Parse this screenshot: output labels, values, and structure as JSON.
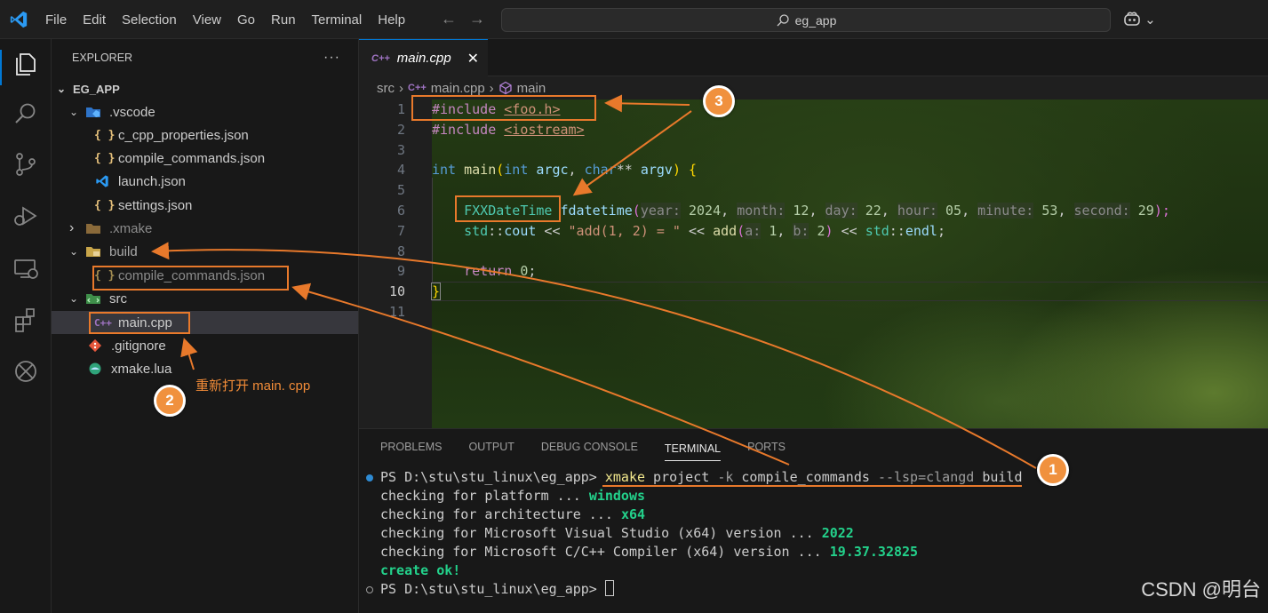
{
  "titlebar": {
    "menu": [
      "File",
      "Edit",
      "Selection",
      "View",
      "Go",
      "Run",
      "Terminal",
      "Help"
    ],
    "search_text": "eg_app",
    "back_glyph": "←",
    "forward_glyph": "→",
    "copilot_glyph": "⌄"
  },
  "sidebar": {
    "header": "EXPLORER",
    "more": "···",
    "tree": [
      {
        "label": "EG_APP",
        "kind": "root"
      },
      {
        "label": ".vscode",
        "kind": "folder-open"
      },
      {
        "label": "c_cpp_properties.json",
        "kind": "json"
      },
      {
        "label": "compile_commands.json",
        "kind": "json"
      },
      {
        "label": "launch.json",
        "kind": "vscode"
      },
      {
        "label": "settings.json",
        "kind": "json"
      },
      {
        "label": ".xmake",
        "kind": "folder-closed"
      },
      {
        "label": "build",
        "kind": "folder-open"
      },
      {
        "label": "compile_commands.json",
        "kind": "json-ignored"
      },
      {
        "label": "src",
        "kind": "folder-open"
      },
      {
        "label": "main.cpp",
        "kind": "cpp",
        "selected": true
      },
      {
        "label": ".gitignore",
        "kind": "git"
      },
      {
        "label": "xmake.lua",
        "kind": "lua"
      }
    ],
    "icons": {
      "json": "{ }",
      "cpp": "C++",
      "chevron_down": "⌄",
      "chevron_right": "›"
    }
  },
  "editor": {
    "tab_label": "main.cpp",
    "tab_close": "✕",
    "breadcrumb": [
      "src",
      "main.cpp",
      "main"
    ],
    "breadcrumb_sep": "›",
    "line_numbers": [
      "1",
      "2",
      "3",
      "4",
      "5",
      "6",
      "7",
      "8",
      "9",
      "10",
      "11"
    ],
    "code": {
      "l1_kw": "#include",
      "l1_inc": "<foo.h>",
      "l2_kw": "#include",
      "l2_inc": "<iostream>",
      "l4_int": "int",
      "l4_main": "main",
      "l4_open": "(",
      "l4_int2": "int",
      "l4_argc": "argc",
      "l4_comma": ", ",
      "l4_char": "char",
      "l4_stars": "**",
      "l4_argv": "argv",
      "l4_close": ") {",
      "l6_type": "FXXDateTime",
      "l6_var": "fdatetime",
      "l6_open": "(",
      "l6_h_year": "year:",
      "l6_v_year": "2024",
      "l6_h_month": "month:",
      "l6_v_month": "12",
      "l6_h_day": "day:",
      "l6_v_day": "22",
      "l6_h_hour": "hour:",
      "l6_v_hour": "05",
      "l6_h_minute": "minute:",
      "l6_v_minute": "53",
      "l6_h_second": "second:",
      "l6_v_second": "29",
      "l6_close": ");",
      "l6_sep": ", ",
      "l7_std": "std",
      "l7_cc": "::",
      "l7_cout": "cout",
      "l7_op": " << ",
      "l7_str": "\"add(1, 2) = \"",
      "l7_add": "add",
      "l7_open": "(",
      "l7_h_a": "a:",
      "l7_v_a": "1",
      "l7_h_b": "b:",
      "l7_v_b": "2",
      "l7_close": ")",
      "l7_std2": "std",
      "l7_endl": "endl",
      "l7_semi": ";",
      "l9_return": "return",
      "l9_zero": "0",
      "l9_semi": ";",
      "l10_brace": "}"
    }
  },
  "panel": {
    "tabs": [
      "PROBLEMS",
      "OUTPUT",
      "DEBUG CONSOLE",
      "TERMINAL",
      "PORTS"
    ],
    "active_tab": "TERMINAL",
    "terminal": {
      "prompt": "PS D:\\stu\\stu_linux\\eg_app> ",
      "cmd_xmake": "xmake",
      "cmd_project": " project ",
      "cmd_k": "-k",
      "cmd_cc": " compile_commands ",
      "cmd_lsp": "--lsp=clangd",
      "cmd_build": " build",
      "l2": "checking for platform ... ",
      "l2_v": "windows",
      "l3": "checking for architecture ... ",
      "l3_v": "x64",
      "l4": "checking for Microsoft Visual Studio (x64) version ... ",
      "l4_v": "2022",
      "l5": "checking for Microsoft C/C++ Compiler (x64) version ... ",
      "l5_v": "19.37.32825",
      "l6": "create ok!",
      "prompt2": "PS D:\\stu\\stu_linux\\eg_app> "
    }
  },
  "annotations": {
    "circle1": "1",
    "circle2": "2",
    "circle3": "3",
    "note2": "重新打开 main. cpp",
    "accent": "#e8792b"
  },
  "watermark": "CSDN @明台",
  "colors": {
    "accent_blue": "#0078d4",
    "annotation_orange": "#e8792b"
  }
}
